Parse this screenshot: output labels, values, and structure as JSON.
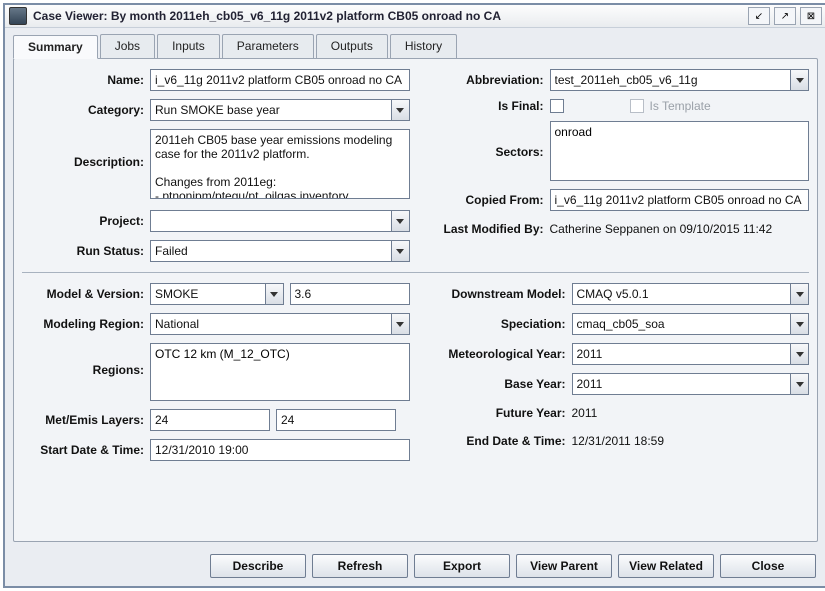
{
  "window": {
    "title": "Case Viewer: By month 2011eh_cb05_v6_11g 2011v2 platform CB05 onroad no CA"
  },
  "tabs": [
    "Summary",
    "Jobs",
    "Inputs",
    "Parameters",
    "Outputs",
    "History"
  ],
  "active_tab": "Summary",
  "left": {
    "name_label": "Name:",
    "name": "i_v6_11g 2011v2 platform CB05 onroad no CA",
    "category_label": "Category:",
    "category": "Run SMOKE base year",
    "description_label": "Description:",
    "description": "2011eh CB05 base year emissions modeling case for the 2011v2 platform.\n\nChanges from 2011eg:\n- ptnonipm/ptegu/pt_oilgas inventory",
    "project_label": "Project:",
    "project": "",
    "run_status_label": "Run Status:",
    "run_status": "Failed"
  },
  "right": {
    "abbreviation_label": "Abbreviation:",
    "abbreviation": "test_2011eh_cb05_v6_11g",
    "is_final_label": "Is Final:",
    "is_template_label": "Is Template",
    "sectors_label": "Sectors:",
    "sectors": "onroad",
    "copied_from_label": "Copied From:",
    "copied_from": "i_v6_11g 2011v2 platform CB05 onroad no CA",
    "last_modified_label": "Last Modified By:",
    "last_modified": "Catherine Seppanen on 09/10/2015 11:42"
  },
  "bottom_left": {
    "model_version_label": "Model & Version:",
    "model": "SMOKE",
    "version": "3.6",
    "modeling_region_label": "Modeling Region:",
    "modeling_region": "National",
    "regions_label": "Regions:",
    "regions": "OTC 12 km (M_12_OTC)",
    "met_layers_label": "Met/Emis Layers:",
    "met_layers_a": "24",
    "met_layers_b": "24",
    "start_dt_label": "Start Date & Time:",
    "start_dt": "12/31/2010 19:00"
  },
  "bottom_right": {
    "downstream_label": "Downstream Model:",
    "downstream": "CMAQ v5.0.1",
    "speciation_label": "Speciation:",
    "speciation": "cmaq_cb05_soa",
    "met_year_label": "Meteorological Year:",
    "met_year": "2011",
    "base_year_label": "Base Year:",
    "base_year": "2011",
    "future_year_label": "Future Year:",
    "future_year": "2011",
    "end_dt_label": "End Date & Time:",
    "end_dt": "12/31/2011 18:59"
  },
  "buttons": {
    "describe": "Describe",
    "refresh": "Refresh",
    "export": "Export",
    "view_parent": "View Parent",
    "view_related": "View Related",
    "close": "Close"
  }
}
